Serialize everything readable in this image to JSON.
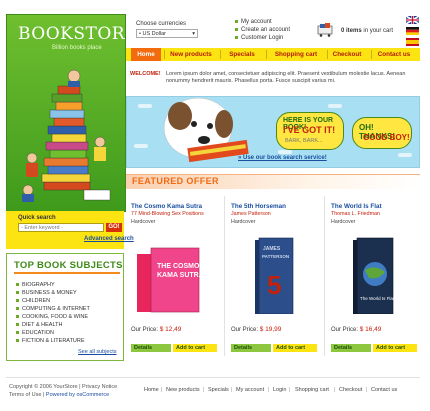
{
  "brand": {
    "logo": "BOOKSTORE",
    "tagline": "Billion books place"
  },
  "header": {
    "currency_label": "Choose currencies",
    "currency_value": "US Dollar",
    "account_links": [
      "My account",
      "Create an account",
      "Customer Login"
    ],
    "cart_count": "0 items",
    "cart_suffix": "in your cart"
  },
  "nav": [
    "Home",
    "New products",
    "Specials",
    "Shopping cart",
    "Checkout",
    "Contact us"
  ],
  "welcome": {
    "label": "WELCOME!",
    "text": "Lorem ipsum dolor amet, consectetuer adipiscing elit. Praesent vestibulum molestie lacus. Aenean nonummy hendrerit mauris. Phasellus porta. Fusce suscipit varius mi."
  },
  "banner": {
    "bubble1_line1": "HERE IS YOUR BOOK!",
    "bubble1_line2": "I'VE GOT IT!",
    "bubble1_line3": "BARK, BARK...",
    "bubble2_line1": "OH! THANKS!",
    "bubble2_line2": "GOOD BOY!",
    "link": "Use our book search service!"
  },
  "search": {
    "label": "Quick search",
    "placeholder": "- Enter keyword -",
    "go": "GO!",
    "advanced": "Advanced search"
  },
  "subjects": {
    "title": "TOP BOOK SUBJECTS",
    "items": [
      "Biography",
      "Business & Money",
      "Children",
      "Computing & Internet",
      "Cooking, Food & Wine",
      "Diet & Health",
      "Education",
      "Fiction & Literature"
    ],
    "see_all": "See all subjects"
  },
  "featured": {
    "title": "FEATURED OFFER",
    "products": [
      {
        "title": "The Cosmo Kama Sutra",
        "subtitle": "77 Mind-Blowing Sex Positions",
        "format": "Hardcover",
        "price_label": "Our Price:",
        "price": "$ 12,49",
        "details": "Details",
        "add": "Add to cart",
        "cover_color": "#e8265d"
      },
      {
        "title": "The 5th Horseman",
        "subtitle": "James Patterson",
        "format": "Hardcover",
        "price_label": "Our Price:",
        "price": "$ 19,99",
        "details": "Details",
        "add": "Add to cart",
        "cover_color": "#2c4e8a"
      },
      {
        "title": "The World Is Flat",
        "subtitle": "Thomas L. Friedman",
        "format": "Hardcover",
        "price_label": "Our Price:",
        "price": "$ 16,49",
        "details": "Details",
        "add": "Add to cart",
        "cover_color": "#1b2f4e"
      }
    ]
  },
  "footer": {
    "copyright": "Copyright © 2006 YourStore  |  Privacy Notice",
    "terms": "Terms of Use",
    "powered": "Powered by osCommerce",
    "links": [
      "Home",
      "New products",
      "Specials",
      "My account",
      "Login",
      "Shopping cart",
      "Checkout",
      "Contact us"
    ]
  }
}
